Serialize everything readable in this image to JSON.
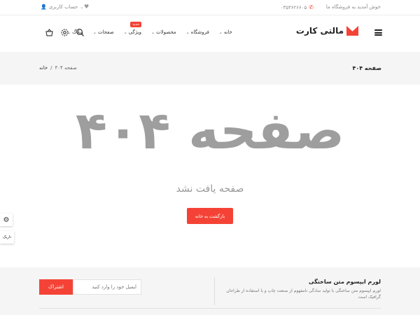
{
  "topbar": {
    "welcome": "خوش آمدید به فروشگاه ما",
    "phone": "۰۳۵۳۶۲۶۶۰۵",
    "account": "حساب کاربری",
    "icons": {
      "phone": "phone-icon",
      "user": "user-icon",
      "heart": "heart-icon",
      "chevron": "chevron-down-icon"
    }
  },
  "header": {
    "logo_text": "مالتی کارت",
    "nav": [
      {
        "label": "خانه"
      },
      {
        "label": "فروشگاه"
      },
      {
        "label": "محصولات"
      },
      {
        "label": "ویژگی",
        "badge": "جدید"
      },
      {
        "label": "صفحات"
      },
      {
        "label": "وبلاگ"
      }
    ],
    "icons": [
      "basket-icon",
      "gear-icon",
      "search-icon"
    ]
  },
  "titlebar": {
    "title": "صفحه ۴۰۴",
    "breadcrumb_home": "خانه",
    "breadcrumb_sep": "/",
    "breadcrumb_current": "صفحه ۴۰۴"
  },
  "main": {
    "big_title": "صفحه ۴۰۴",
    "subtitle": "صفحه یافت نشد",
    "back_button": "بازگشت به خانه"
  },
  "side": {
    "dark_label": "تاریک"
  },
  "newsletter": {
    "title": "لورم ایپسوم متن ساختگی",
    "description": "لورم ایپسوم متن ساختگی با تولید سادگی نامفهوم از صنعت چاپ و با استفاده از طراحان گرافیک است",
    "placeholder": "ایمیل خود را وارد کنید",
    "button": "اشتراک"
  },
  "colors": {
    "accent": "#f44336",
    "muted": "#9e9e9e"
  }
}
